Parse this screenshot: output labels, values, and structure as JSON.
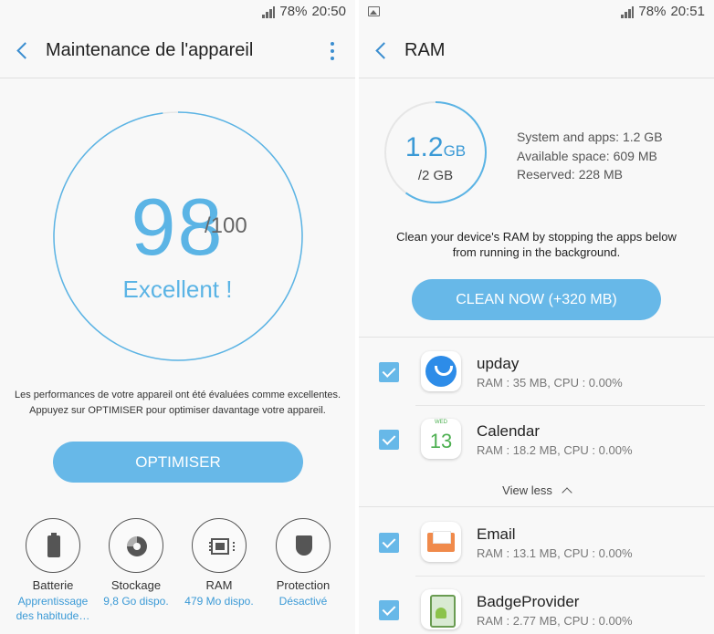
{
  "left": {
    "status": {
      "battery": "78%",
      "time": "20:50"
    },
    "appbar": {
      "title": "Maintenance de l'appareil"
    },
    "score": {
      "value": "98",
      "max": "/100",
      "fraction": 0.98,
      "label": "Excellent !"
    },
    "description": [
      "Les performances de votre appareil ont été évaluées comme excellentes.",
      "Appuyez sur OPTIMISER pour optimiser davantage votre appareil."
    ],
    "optimize_button": "OPTIMISER",
    "features": [
      {
        "name": "Batterie",
        "sub": [
          "Apprentissage",
          "des habitude…"
        ],
        "icon": "battery-icon"
      },
      {
        "name": "Stockage",
        "sub": [
          "9,8 Go dispo."
        ],
        "icon": "storage-icon"
      },
      {
        "name": "RAM",
        "sub": [
          "479 Mo dispo."
        ],
        "icon": "ram-icon"
      },
      {
        "name": "Protection",
        "sub": [
          "Désactivé"
        ],
        "icon": "shield-icon"
      }
    ]
  },
  "right": {
    "status": {
      "battery": "78%",
      "time": "20:51"
    },
    "appbar": {
      "title": "RAM"
    },
    "ram": {
      "used": "1.2",
      "used_unit": "GB",
      "total": "/2 GB",
      "fraction": 0.6
    },
    "stats": [
      "System and apps: 1.2 GB",
      "Available space: 609 MB",
      "Reserved: 228 MB"
    ],
    "description": [
      "Clean your device's RAM by stopping the apps below",
      "from running in the background."
    ],
    "clean_button": "CLEAN NOW (+320 MB)",
    "apps_top": [
      {
        "name": "upday",
        "meta": "RAM : 35 MB, CPU : 0.00%",
        "checked": true,
        "icon": "upday-icon"
      },
      {
        "name": "Calendar",
        "meta": "RAM : 18.2 MB, CPU : 0.00%",
        "checked": true,
        "icon": "calendar-icon",
        "icon_day": "WED",
        "icon_num": "13"
      }
    ],
    "view_less": "View less",
    "apps_bottom": [
      {
        "name": "Email",
        "meta": "RAM : 13.1 MB, CPU : 0.00%",
        "checked": true,
        "icon": "email-icon"
      },
      {
        "name": "BadgeProvider",
        "meta": "RAM : 2.77 MB, CPU : 0.00%",
        "checked": true,
        "icon": "badge-provider-icon"
      }
    ]
  },
  "colors": {
    "accent": "#5bb4e5",
    "button": "#67b8e8",
    "link": "#3b9ad6",
    "ring_track": "#e6e6e6"
  }
}
